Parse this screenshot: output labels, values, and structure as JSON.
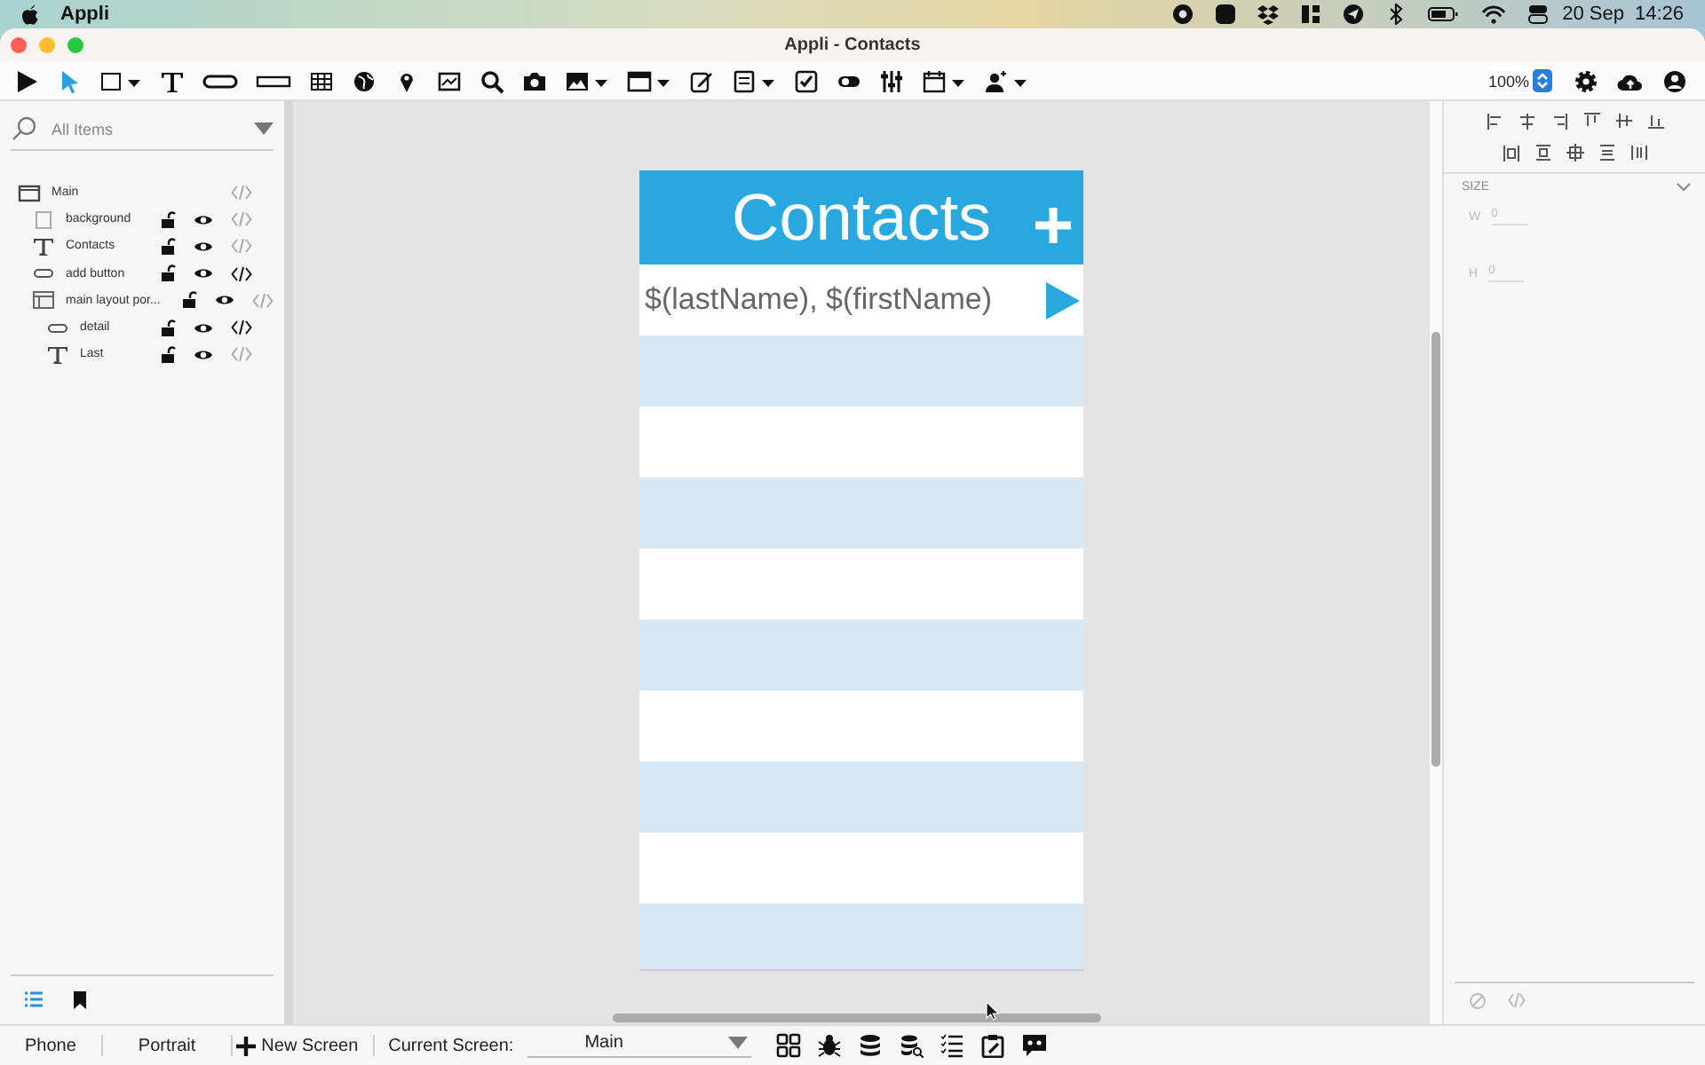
{
  "menu_bar": {
    "app": "Appli",
    "date": "20 Sep",
    "time": "14:26"
  },
  "window": {
    "title": "Appli - Contacts"
  },
  "toolbar": {
    "zoom": "100%"
  },
  "layers": {
    "filter": "All Items",
    "tree": [
      {
        "label": "Main",
        "kind": "screen",
        "code": false,
        "children": [
          {
            "label": "background",
            "kind": "rect",
            "code": false,
            "locked": false,
            "visible": true
          },
          {
            "label": "Contacts",
            "kind": "text",
            "code": false,
            "locked": false,
            "visible": true
          },
          {
            "label": "add button",
            "kind": "button",
            "code": true,
            "locked": false,
            "visible": true
          },
          {
            "label": "main layout por...",
            "kind": "list",
            "code": false,
            "locked": false,
            "visible": true,
            "children": [
              {
                "label": "detail",
                "kind": "button",
                "code": true,
                "locked": false,
                "visible": true
              },
              {
                "label": "Last",
                "kind": "text",
                "code": false,
                "locked": false,
                "visible": true
              }
            ]
          }
        ]
      }
    ]
  },
  "panel_tabs": [
    {
      "kind": "layers",
      "selected": true
    },
    {
      "kind": "bookmarks",
      "selected": false
    }
  ],
  "screen": {
    "title": "Contacts",
    "row_template": "$(lastName), $(firstName)"
  },
  "inspector": {
    "section": "SIZE",
    "fields": [
      {
        "label": "W",
        "value": "0"
      },
      {
        "label": "H",
        "value": "0"
      }
    ]
  },
  "bottom_bar": {
    "device": "Phone",
    "orientation": "Portrait",
    "new_screen": "New Screen",
    "current_label": "Current Screen:",
    "current": "Main"
  }
}
